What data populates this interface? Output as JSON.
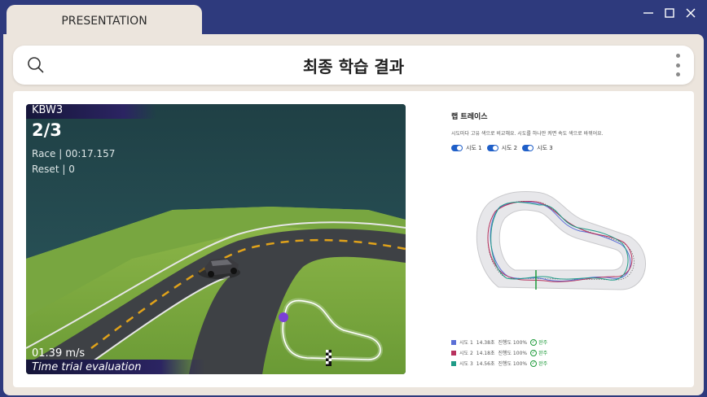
{
  "tab": {
    "label": "PRESENTATION"
  },
  "window_controls": {
    "minimize": "—",
    "maximize": "☐",
    "close": "✕"
  },
  "header": {
    "title": "최종 학습 결과",
    "search_icon": "search-icon",
    "menu_icon": "kebab-menu-icon"
  },
  "video": {
    "car_name": "KBW3",
    "lap": "2/3",
    "race_time": "Race | 00:17.157",
    "reset": "Reset | 0",
    "speed": "01.39 m/s",
    "mode": "Time trial evaluation"
  },
  "lap_trace": {
    "title": "랩 트레이스",
    "description": "시도마다 고유 색으로 비교해요. 시도를 하나만 켜면 속도 색으로 바뀌어요.",
    "toggles": [
      {
        "label": "시도 1",
        "on": true
      },
      {
        "label": "시도 2",
        "on": true
      },
      {
        "label": "시도 3",
        "on": true
      }
    ],
    "legend": [
      {
        "attempt": "시도 1",
        "time": "14.38초",
        "progress": "진행도 100%",
        "status": "완주",
        "color": "#5b6fd6"
      },
      {
        "attempt": "시도 2",
        "time": "14.18초",
        "progress": "진행도 100%",
        "status": "완주",
        "color": "#b8325e"
      },
      {
        "attempt": "시도 3",
        "time": "14.56초",
        "progress": "진행도 100%",
        "status": "완주",
        "color": "#1f9b87"
      }
    ]
  },
  "colors": {
    "frame": "#2e3a7d",
    "tab_bg": "#ece5dd",
    "accent_toggle": "#1f5fc8",
    "done_green": "#1e9a3a"
  }
}
